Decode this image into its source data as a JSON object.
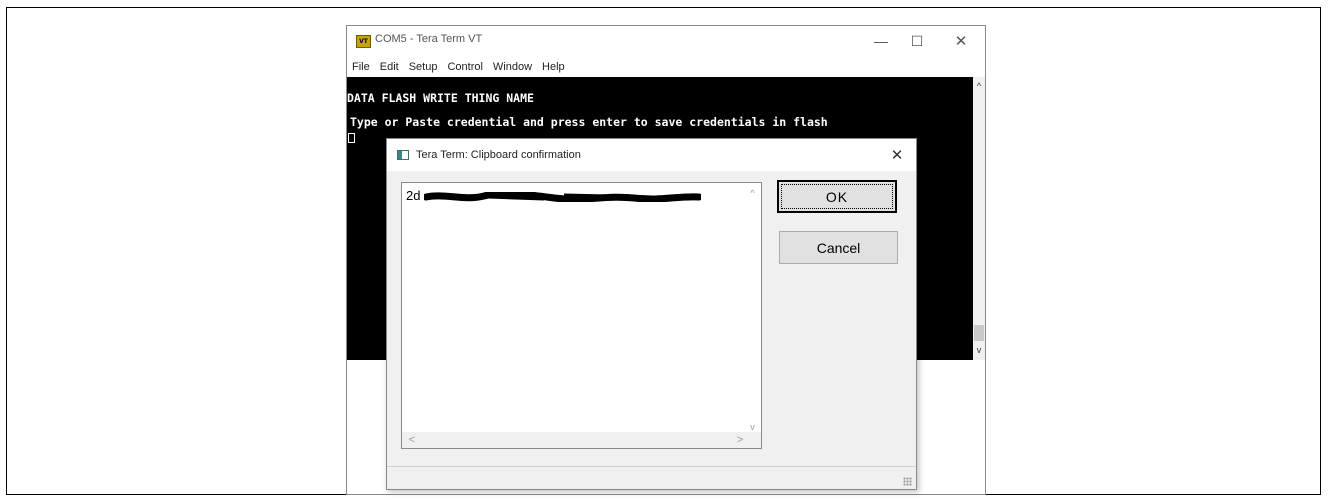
{
  "window": {
    "icon_text": "VT",
    "title": "COM5 - Tera Term VT",
    "controls": {
      "minimize": "—",
      "maximize": "☐",
      "close": "✕"
    }
  },
  "menubar": [
    "File",
    "Edit",
    "Setup",
    "Control",
    "Window",
    "Help"
  ],
  "terminal": {
    "lines": [
      "DATA FLASH WRITE THING NAME",
      "Type or Paste credential and press enter to save credentials in flash"
    ],
    "scroll_up": "^",
    "scroll_down": "v"
  },
  "dialog": {
    "title": "Tera Term: Clipboard confirmation",
    "close": "✕",
    "clipboard_text_visible": "2d",
    "buttons": {
      "ok": "OK",
      "cancel": "Cancel"
    },
    "scroll": {
      "up": "^",
      "down": "v",
      "left": "<",
      "right": ">"
    }
  }
}
